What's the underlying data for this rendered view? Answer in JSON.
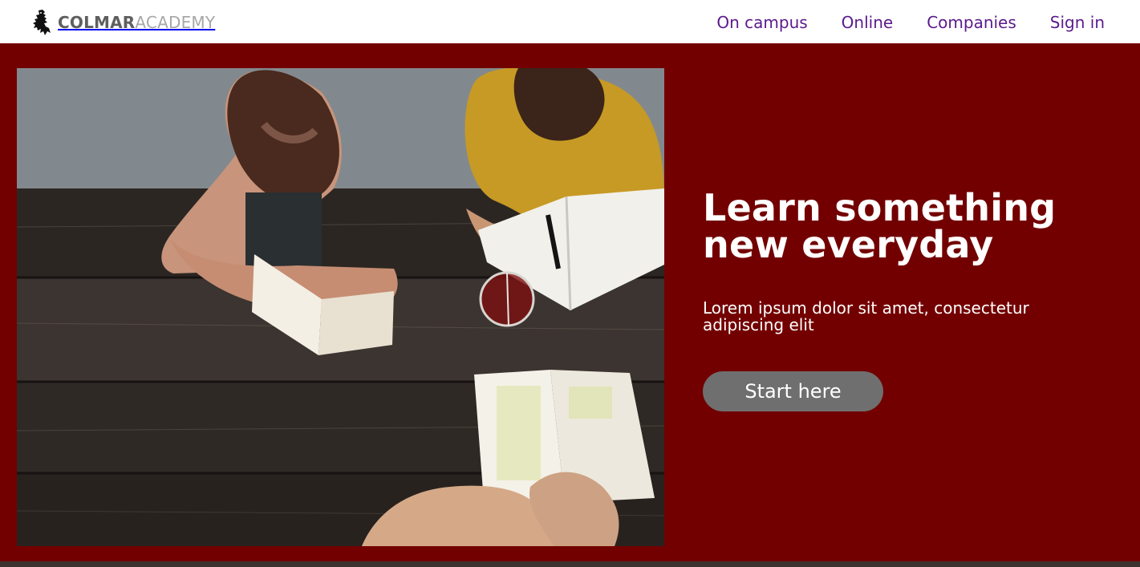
{
  "brand": {
    "name_bold": "COLMAR",
    "name_light": "ACADEMY",
    "icon": "lion-rampant-icon"
  },
  "nav": {
    "items": [
      {
        "label": "On campus"
      },
      {
        "label": "Online"
      },
      {
        "label": "Companies"
      },
      {
        "label": "Sign in"
      }
    ]
  },
  "hero": {
    "title": "Learn something new everyday",
    "subtitle": "Lorem ipsum dolor sit amet, consectetur adipiscing elit",
    "cta_label": "Start here",
    "image": "students-reading-at-picnic-table-photo"
  },
  "colors": {
    "hero_background": "#730000",
    "nav_link": "#5b1a8d",
    "button": "#6f6f6f",
    "logo_bold": "#5f5f5f",
    "logo_light": "#a7a7a7"
  }
}
